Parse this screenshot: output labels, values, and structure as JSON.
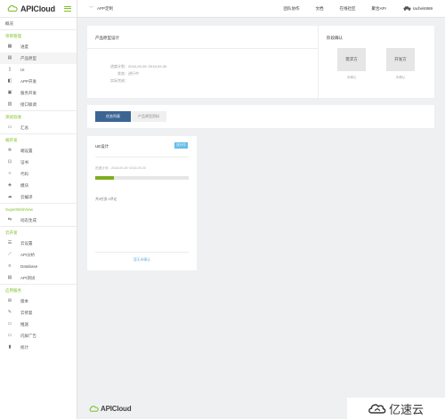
{
  "brand": {
    "name": "APICloud",
    "accent": "#7fbf2a"
  },
  "header": {
    "breadcrumb": "APP定制",
    "nav": [
      "团队协作",
      "文档",
      "在线社区",
      "聚合API"
    ],
    "username": "rachel4869"
  },
  "sidebar": {
    "overview": "概况",
    "sections": [
      {
        "title": "项目管理",
        "items": [
          {
            "label": "进度",
            "icon": "progress-icon"
          },
          {
            "label": "产品原型",
            "icon": "prototype-icon",
            "active": true
          },
          {
            "label": "UI",
            "icon": "ui-icon"
          },
          {
            "label": "APP开发",
            "icon": "app-dev-icon"
          },
          {
            "label": "服务开发",
            "icon": "service-dev-icon"
          },
          {
            "label": "接口联调",
            "icon": "interface-debug-icon"
          }
        ]
      },
      {
        "title": "测试验收",
        "items": [
          {
            "label": "汇总",
            "icon": "summary-icon"
          }
        ]
      },
      {
        "title": "端开发",
        "items": [
          {
            "label": "端设置",
            "icon": "gear-icon"
          },
          {
            "label": "证书",
            "icon": "certificate-icon"
          },
          {
            "label": "代码",
            "icon": "code-icon"
          },
          {
            "label": "模块",
            "icon": "module-icon"
          },
          {
            "label": "云编译",
            "icon": "cloud-compile-icon"
          }
        ]
      },
      {
        "title": "SuperWebView",
        "items": [
          {
            "label": "动态生成",
            "icon": "dynamic-generate-icon"
          }
        ]
      },
      {
        "title": "云开发",
        "items": [
          {
            "label": "云设置",
            "icon": "cloud-settings-icon"
          },
          {
            "label": "API分析",
            "icon": "chart-icon"
          },
          {
            "label": "Database",
            "icon": "database-icon"
          },
          {
            "label": "API测试",
            "icon": "api-test-icon"
          }
        ]
      },
      {
        "title": "应用服务",
        "items": [
          {
            "label": "版本",
            "icon": "version-icon"
          },
          {
            "label": "云修复",
            "icon": "wrench-icon"
          },
          {
            "label": "推送",
            "icon": "push-icon"
          },
          {
            "label": "闪屏广告",
            "icon": "splash-ad-icon"
          },
          {
            "label": "统计",
            "icon": "statistics-icon"
          }
        ]
      }
    ]
  },
  "project": {
    "title": "产品原型设计",
    "plan_label": "进度计划：",
    "plan_value": "2016-09-26~2016-09-30",
    "status_label": "状态：",
    "status_value": "进行中",
    "actual_label": "实际完成：",
    "actual_value": "",
    "phase_title": "阶段确认",
    "phases": [
      {
        "label": "需求方",
        "status": "未确认"
      },
      {
        "label": "开发方",
        "status": "未确认"
      }
    ]
  },
  "tabs": {
    "active": "任务列表",
    "inactive": "产品原型资料"
  },
  "task_card": {
    "title": "UE设计",
    "badge": "进行中",
    "plan": "进度计划：2016-09-26~2016-09-30",
    "progress": 0.2,
    "tasks": "共0任务 0评论",
    "link": "暂无未确认"
  },
  "footer": {
    "logo": "APICloud",
    "watermark": "亿速云"
  }
}
